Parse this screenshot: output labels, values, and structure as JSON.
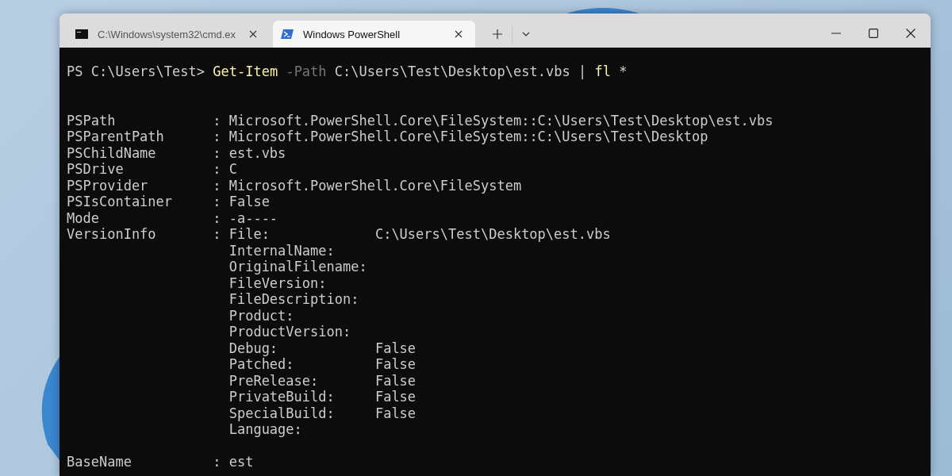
{
  "window": {
    "tabs": [
      {
        "kind": "cmd",
        "title": "C:\\Windows\\system32\\cmd.ex",
        "selected": false
      },
      {
        "kind": "powershell",
        "title": "Windows PowerShell",
        "selected": true
      }
    ]
  },
  "terminal": {
    "command": {
      "prompt": "PS C:\\Users\\Test>",
      "cmdlet": "Get-Item",
      "parameter": "-Path",
      "argument": "C:\\Users\\Test\\Desktop\\est.vbs",
      "pipe": "|",
      "format_cmd": "fl",
      "wildcard": "*"
    },
    "properties": [
      {
        "name": "PSPath",
        "colon": ":",
        "value": "Microsoft.PowerShell.Core\\FileSystem::C:\\Users\\Test\\Desktop\\est.vbs"
      },
      {
        "name": "PSParentPath",
        "colon": ":",
        "value": "Microsoft.PowerShell.Core\\FileSystem::C:\\Users\\Test\\Desktop"
      },
      {
        "name": "PSChildName",
        "colon": ":",
        "value": "est.vbs"
      },
      {
        "name": "PSDrive",
        "colon": ":",
        "value": "C"
      },
      {
        "name": "PSProvider",
        "colon": ":",
        "value": "Microsoft.PowerShell.Core\\FileSystem"
      },
      {
        "name": "PSIsContainer",
        "colon": ":",
        "value": "False"
      },
      {
        "name": "Mode",
        "colon": ":",
        "value": "-a----"
      },
      {
        "name": "VersionInfo",
        "colon": ":",
        "fields": [
          {
            "name": "File:",
            "value": "C:\\Users\\Test\\Desktop\\est.vbs"
          },
          {
            "name": "InternalName:"
          },
          {
            "name": "OriginalFilename:"
          },
          {
            "name": "FileVersion:"
          },
          {
            "name": "FileDescription:"
          },
          {
            "name": "Product:"
          },
          {
            "name": "ProductVersion:"
          },
          {
            "name": "Debug:",
            "value": "False"
          },
          {
            "name": "Patched:",
            "value": "False"
          },
          {
            "name": "PreRelease:",
            "value": "False"
          },
          {
            "name": "PrivateBuild:",
            "value": "False"
          },
          {
            "name": "SpecialBuild:",
            "value": "False"
          },
          {
            "name": "Language:"
          }
        ]
      },
      {
        "name": "BaseName",
        "colon": ":",
        "value": "est"
      }
    ]
  }
}
